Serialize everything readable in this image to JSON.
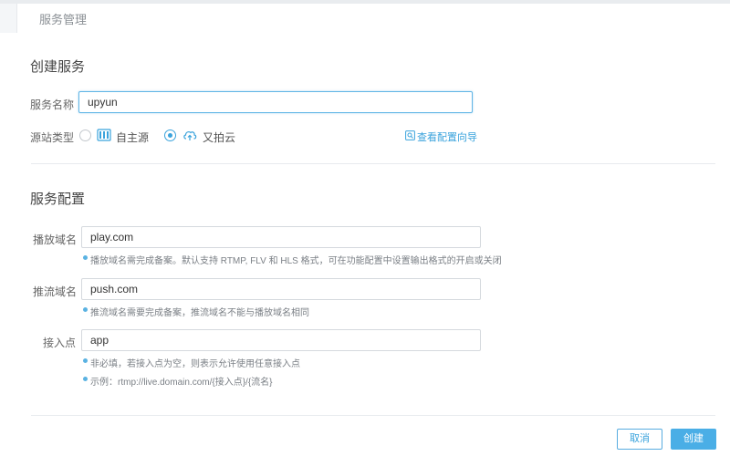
{
  "header": {
    "title": "服务管理"
  },
  "create_section": {
    "title": "创建服务",
    "service_name": {
      "label": "服务名称",
      "value": "upyun"
    },
    "source_type": {
      "label": "源站类型",
      "options": [
        {
          "label": "自主源",
          "icon": "server-rack-icon",
          "selected": false
        },
        {
          "label": "又拍云",
          "icon": "cloud-upload-icon",
          "selected": true
        }
      ]
    },
    "guide_link": {
      "label": "查看配置向导",
      "icon": "guide-icon"
    }
  },
  "config_section": {
    "title": "服务配置",
    "play_domain": {
      "label": "播放域名",
      "value": "play.com",
      "hint": "播放域名需完成备案。默认支持 RTMP, FLV 和 HLS 格式，可在功能配置中设置输出格式的开启或关闭"
    },
    "push_domain": {
      "label": "推流域名",
      "value": "push.com",
      "hint": "推流域名需要完成备案，推流域名不能与播放域名相同"
    },
    "access_point": {
      "label": "接入点",
      "value": "app",
      "hint": "非必填，若接入点为空，则表示允许使用任意接入点",
      "example": "示例：rtmp://live.domain.com/{接入点}/{流名}"
    }
  },
  "footer": {
    "cancel_label": "取消",
    "create_label": "创建"
  },
  "colors": {
    "accent": "#3aa3dc",
    "border": "#d5d9de",
    "text": "#555555"
  }
}
